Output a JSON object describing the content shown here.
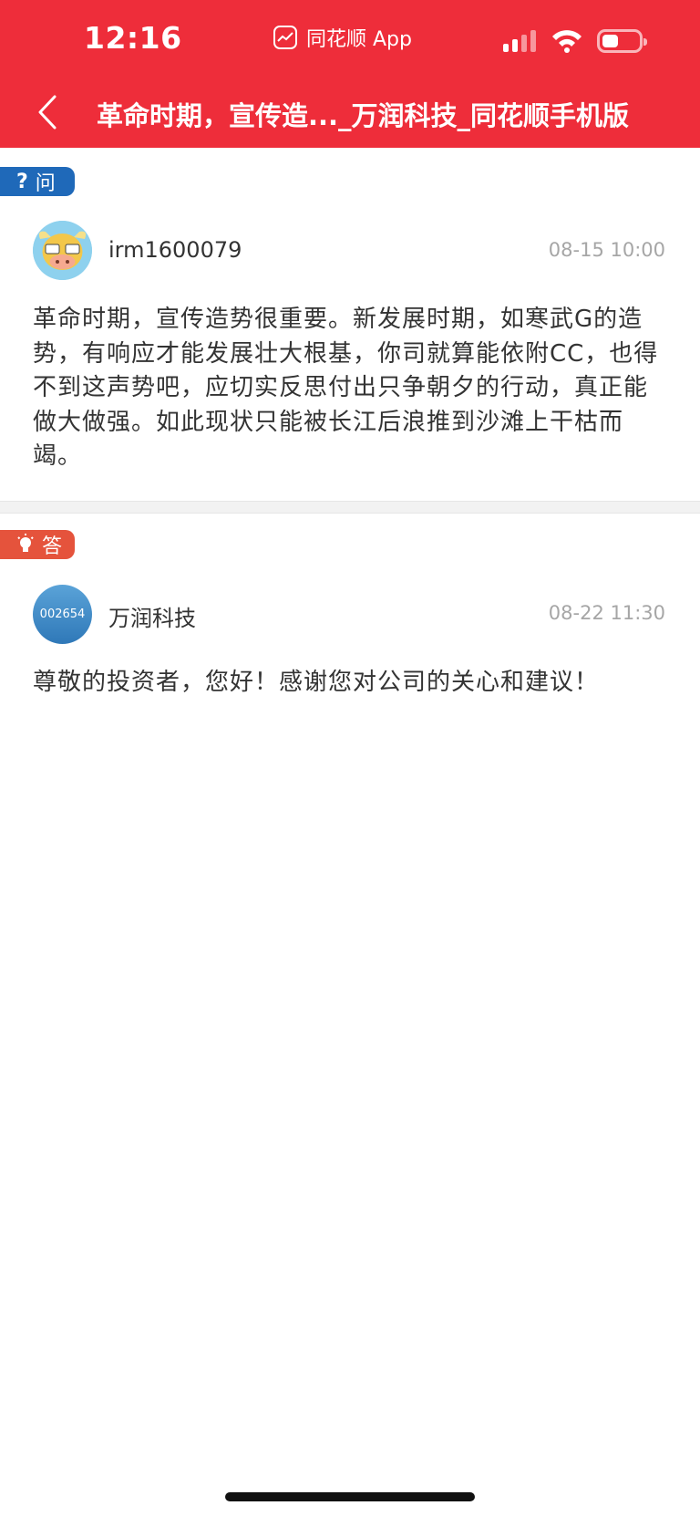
{
  "status_bar": {
    "time": "12:16",
    "app_name": "同花顺 App",
    "icons": [
      "signal-icon",
      "wifi-icon",
      "battery-icon"
    ]
  },
  "nav": {
    "title": "革命时期，宣传造..._万润科技_同花顺手机版",
    "back_icon": "chevron-left-icon"
  },
  "question": {
    "badge_icon": "?",
    "badge_label": "问",
    "username": "irm1600079",
    "time": "08-15 10:00",
    "content": "革命时期，宣传造势很重要。新发展时期，如寒武G的造势，有响应才能发展壮大根基，你司就算能依附CC，也得不到这声势吧，应切实反思付出只争朝夕的行动，真正能做大做强。如此现状只能被长江后浪推到沙滩上干枯而竭。"
  },
  "answer": {
    "badge_label": "答",
    "avatar_text": "002654",
    "username": "万润科技",
    "time": "08-22 11:30",
    "content": "尊敬的投资者，您好！感谢您对公司的关心和建议！"
  },
  "colors": {
    "header": "#ee2d3a",
    "question_badge": "#1f69b9",
    "answer_badge": "#e5533c",
    "timestamp": "#a6a6a6"
  }
}
